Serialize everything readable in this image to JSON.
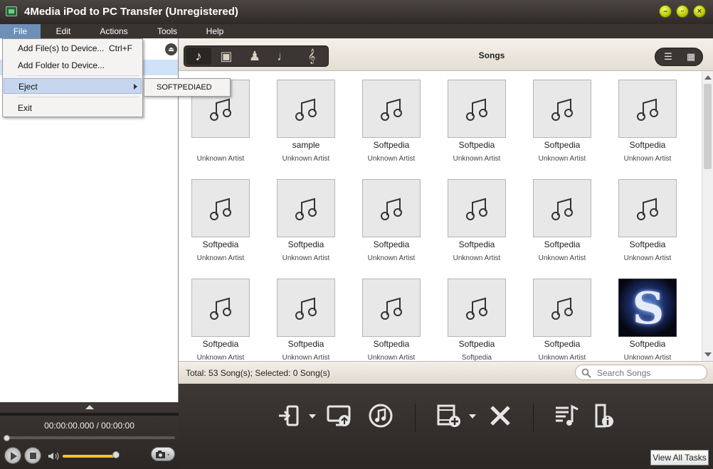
{
  "window": {
    "title": "4Media iPod to PC Transfer (Unregistered)"
  },
  "menubar": {
    "items": [
      "File",
      "Edit",
      "Actions",
      "Tools",
      "Help"
    ]
  },
  "file_menu": {
    "add_files": "Add File(s) to Device...",
    "add_files_shortcut": "Ctrl+F",
    "add_folder": "Add Folder to Device...",
    "eject": "Eject",
    "exit": "Exit",
    "eject_submenu_item": "SOFTPEDIAED"
  },
  "toolbar": {
    "section_title": "Songs",
    "categories": [
      "music-note-icon",
      "music-video-icon",
      "artist-icon",
      "guitar-icon",
      "treble-clef-icon"
    ]
  },
  "songs": [
    {
      "title": "",
      "artist": "Unknown Artist"
    },
    {
      "title": "sample",
      "artist": "Unknown Artist"
    },
    {
      "title": "Softpedia",
      "artist": "Unknown Artist"
    },
    {
      "title": "Softpedia",
      "artist": "Unknown Artist"
    },
    {
      "title": "Softpedia",
      "artist": "Unknown Artist"
    },
    {
      "title": "Softpedia",
      "artist": "Unknown Artist"
    },
    {
      "title": "Softpedia",
      "artist": "Unknown Artist"
    },
    {
      "title": "Softpedia",
      "artist": "Unknown Artist"
    },
    {
      "title": "Softpedia",
      "artist": "Unknown Artist"
    },
    {
      "title": "Softpedia",
      "artist": "Unknown Artist"
    },
    {
      "title": "Softpedia",
      "artist": "Unknown Artist"
    },
    {
      "title": "Softpedia",
      "artist": "Unknown Artist"
    },
    {
      "title": "Softpedia",
      "artist": "Unknown Artist"
    },
    {
      "title": "Softpedia",
      "artist": "Unknown Artist"
    },
    {
      "title": "Softpedia",
      "artist": "Unknown Artist"
    },
    {
      "title": "Softpedia",
      "artist": "Softpedia"
    },
    {
      "title": "Softpedia",
      "artist": "Unknown Artist"
    },
    {
      "title": "Softpedia",
      "artist": "Unknown Artist",
      "art_letter": "S"
    }
  ],
  "status": {
    "summary": "Total: 53 Song(s); Selected: 0 Song(s)",
    "search_placeholder": "Search Songs"
  },
  "player": {
    "time": "00:00:00.000 / 00:00:00",
    "volume_level": 0.95
  },
  "bottom": {
    "view_all": "View All Tasks"
  },
  "colors": {
    "accent_volume": "#f2c81a",
    "menu_highlight": "#6e8fb8",
    "device_selected": "#cfe2f7"
  }
}
